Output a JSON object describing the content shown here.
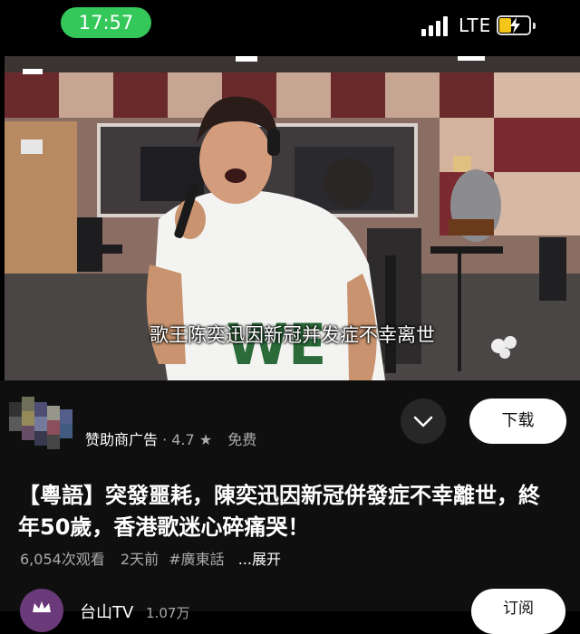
{
  "status_bar": {
    "time": "17:57",
    "network": "LTE",
    "time_pill_color": "#34c759",
    "battery_color": "#f5c518"
  },
  "video": {
    "subtitle": "歌王陈奕迅因新冠并发症不幸离世",
    "shirt_text": "WE"
  },
  "ad": {
    "sponsor_label": "赞助商广告",
    "rating": "· 4.7 ★",
    "price": "免费",
    "download_label": "下载"
  },
  "title": {
    "text": "【粵語】突發噩耗，陳奕迅因新冠併發症不幸離世，終年50歲，香港歌迷心碎痛哭！",
    "views": "6,054次观看",
    "age": "2天前",
    "hashtag": "#廣東話",
    "more_label": "...展开"
  },
  "channel": {
    "name": "台山TV",
    "subscribers": "1.07万",
    "subscribe_label": "订阅"
  },
  "icons": {
    "expand": "chevron-down-icon",
    "signal": "signal-icon",
    "battery": "battery-charging-icon"
  }
}
